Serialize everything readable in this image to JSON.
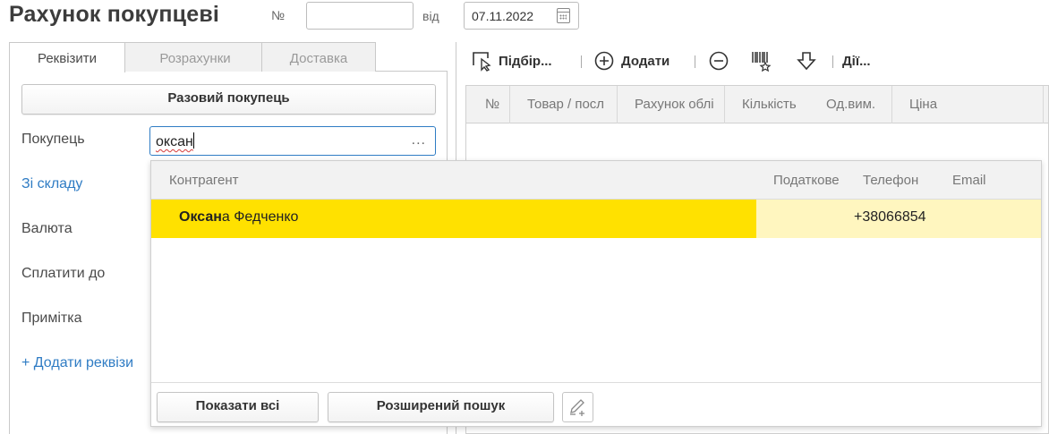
{
  "header": {
    "title": "Рахунок покупцеві",
    "number_label": "№",
    "number_value": "",
    "date_label": "від",
    "date_value": "07.11.2022"
  },
  "tabs": [
    {
      "label": "Реквізити",
      "active": true
    },
    {
      "label": "Розрахунки",
      "active": false
    },
    {
      "label": "Доставка",
      "active": false
    }
  ],
  "form": {
    "single_buyer_button": "Разовий покупець",
    "buyer_label": "Покупець",
    "buyer_value": "оксан",
    "buyer_dots": "...",
    "warehouse_link": "Зі складу",
    "currency_label": "Валюта",
    "pay_until_label": "Сплатити до",
    "note_label": "Примітка",
    "add_details_link": "+ Додати реквізи"
  },
  "toolbar": {
    "select_label": "Підбір...",
    "add_label": "Додати",
    "actions_label": "Дії..."
  },
  "grid": {
    "columns": [
      "№",
      "Товар / посл",
      "Рахунок облі",
      "Кількість",
      "Од.вим.",
      "Ціна"
    ]
  },
  "dropdown": {
    "columns": [
      "Контрагент",
      "Податкове",
      "Телефон",
      "Email"
    ],
    "rows": [
      {
        "name_match": "Оксан",
        "name_rest": "а Федченко",
        "tax": "",
        "phone": "+38066854",
        "email": ""
      }
    ],
    "show_all_button": "Показати всі",
    "advanced_search_button": "Розширений пошук"
  },
  "colors": {
    "highlight": "#ffe100",
    "highlight_light": "#fff6bf",
    "link": "#2f7cc4"
  }
}
